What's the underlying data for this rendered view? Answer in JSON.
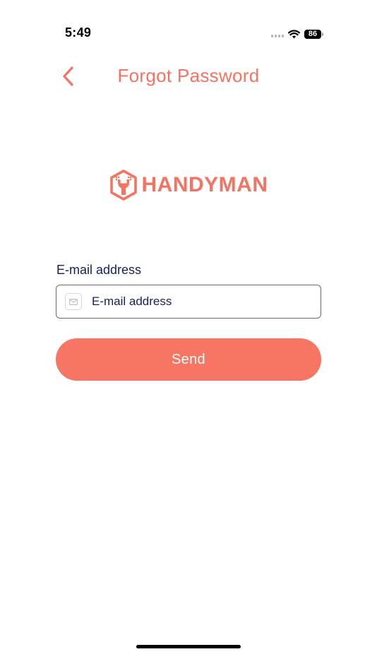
{
  "status_bar": {
    "time": "5:49",
    "battery_level": "86",
    "icons": [
      "signal-icon",
      "wifi-icon",
      "battery-icon"
    ]
  },
  "header": {
    "back_icon": "chevron-left-icon",
    "title": "Forgot Password"
  },
  "logo": {
    "icon": "handyman-logo-icon",
    "text": "HANDYMAN"
  },
  "form": {
    "email_label": "E-mail address",
    "email_icon": "mail-icon",
    "email_value": "",
    "email_placeholder": "E-mail address",
    "send_label": "Send"
  },
  "colors": {
    "accent": "#f47461",
    "button": "#f77563",
    "text_primary": "#1a1f5c",
    "input_border": "#6b6b6b"
  }
}
